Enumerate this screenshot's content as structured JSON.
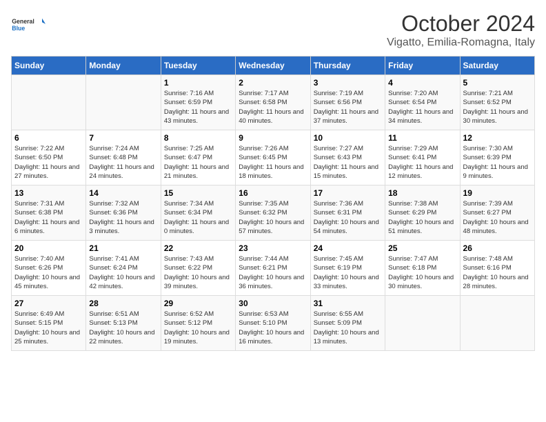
{
  "header": {
    "logo_general": "General",
    "logo_blue": "Blue",
    "month": "October 2024",
    "location": "Vigatto, Emilia-Romagna, Italy"
  },
  "days_of_week": [
    "Sunday",
    "Monday",
    "Tuesday",
    "Wednesday",
    "Thursday",
    "Friday",
    "Saturday"
  ],
  "weeks": [
    [
      {
        "day": "",
        "info": ""
      },
      {
        "day": "",
        "info": ""
      },
      {
        "day": "1",
        "info": "Sunrise: 7:16 AM\nSunset: 6:59 PM\nDaylight: 11 hours and 43 minutes."
      },
      {
        "day": "2",
        "info": "Sunrise: 7:17 AM\nSunset: 6:58 PM\nDaylight: 11 hours and 40 minutes."
      },
      {
        "day": "3",
        "info": "Sunrise: 7:19 AM\nSunset: 6:56 PM\nDaylight: 11 hours and 37 minutes."
      },
      {
        "day": "4",
        "info": "Sunrise: 7:20 AM\nSunset: 6:54 PM\nDaylight: 11 hours and 34 minutes."
      },
      {
        "day": "5",
        "info": "Sunrise: 7:21 AM\nSunset: 6:52 PM\nDaylight: 11 hours and 30 minutes."
      }
    ],
    [
      {
        "day": "6",
        "info": "Sunrise: 7:22 AM\nSunset: 6:50 PM\nDaylight: 11 hours and 27 minutes."
      },
      {
        "day": "7",
        "info": "Sunrise: 7:24 AM\nSunset: 6:48 PM\nDaylight: 11 hours and 24 minutes."
      },
      {
        "day": "8",
        "info": "Sunrise: 7:25 AM\nSunset: 6:47 PM\nDaylight: 11 hours and 21 minutes."
      },
      {
        "day": "9",
        "info": "Sunrise: 7:26 AM\nSunset: 6:45 PM\nDaylight: 11 hours and 18 minutes."
      },
      {
        "day": "10",
        "info": "Sunrise: 7:27 AM\nSunset: 6:43 PM\nDaylight: 11 hours and 15 minutes."
      },
      {
        "day": "11",
        "info": "Sunrise: 7:29 AM\nSunset: 6:41 PM\nDaylight: 11 hours and 12 minutes."
      },
      {
        "day": "12",
        "info": "Sunrise: 7:30 AM\nSunset: 6:39 PM\nDaylight: 11 hours and 9 minutes."
      }
    ],
    [
      {
        "day": "13",
        "info": "Sunrise: 7:31 AM\nSunset: 6:38 PM\nDaylight: 11 hours and 6 minutes."
      },
      {
        "day": "14",
        "info": "Sunrise: 7:32 AM\nSunset: 6:36 PM\nDaylight: 11 hours and 3 minutes."
      },
      {
        "day": "15",
        "info": "Sunrise: 7:34 AM\nSunset: 6:34 PM\nDaylight: 11 hours and 0 minutes."
      },
      {
        "day": "16",
        "info": "Sunrise: 7:35 AM\nSunset: 6:32 PM\nDaylight: 10 hours and 57 minutes."
      },
      {
        "day": "17",
        "info": "Sunrise: 7:36 AM\nSunset: 6:31 PM\nDaylight: 10 hours and 54 minutes."
      },
      {
        "day": "18",
        "info": "Sunrise: 7:38 AM\nSunset: 6:29 PM\nDaylight: 10 hours and 51 minutes."
      },
      {
        "day": "19",
        "info": "Sunrise: 7:39 AM\nSunset: 6:27 PM\nDaylight: 10 hours and 48 minutes."
      }
    ],
    [
      {
        "day": "20",
        "info": "Sunrise: 7:40 AM\nSunset: 6:26 PM\nDaylight: 10 hours and 45 minutes."
      },
      {
        "day": "21",
        "info": "Sunrise: 7:41 AM\nSunset: 6:24 PM\nDaylight: 10 hours and 42 minutes."
      },
      {
        "day": "22",
        "info": "Sunrise: 7:43 AM\nSunset: 6:22 PM\nDaylight: 10 hours and 39 minutes."
      },
      {
        "day": "23",
        "info": "Sunrise: 7:44 AM\nSunset: 6:21 PM\nDaylight: 10 hours and 36 minutes."
      },
      {
        "day": "24",
        "info": "Sunrise: 7:45 AM\nSunset: 6:19 PM\nDaylight: 10 hours and 33 minutes."
      },
      {
        "day": "25",
        "info": "Sunrise: 7:47 AM\nSunset: 6:18 PM\nDaylight: 10 hours and 30 minutes."
      },
      {
        "day": "26",
        "info": "Sunrise: 7:48 AM\nSunset: 6:16 PM\nDaylight: 10 hours and 28 minutes."
      }
    ],
    [
      {
        "day": "27",
        "info": "Sunrise: 6:49 AM\nSunset: 5:15 PM\nDaylight: 10 hours and 25 minutes."
      },
      {
        "day": "28",
        "info": "Sunrise: 6:51 AM\nSunset: 5:13 PM\nDaylight: 10 hours and 22 minutes."
      },
      {
        "day": "29",
        "info": "Sunrise: 6:52 AM\nSunset: 5:12 PM\nDaylight: 10 hours and 19 minutes."
      },
      {
        "day": "30",
        "info": "Sunrise: 6:53 AM\nSunset: 5:10 PM\nDaylight: 10 hours and 16 minutes."
      },
      {
        "day": "31",
        "info": "Sunrise: 6:55 AM\nSunset: 5:09 PM\nDaylight: 10 hours and 13 minutes."
      },
      {
        "day": "",
        "info": ""
      },
      {
        "day": "",
        "info": ""
      }
    ]
  ]
}
